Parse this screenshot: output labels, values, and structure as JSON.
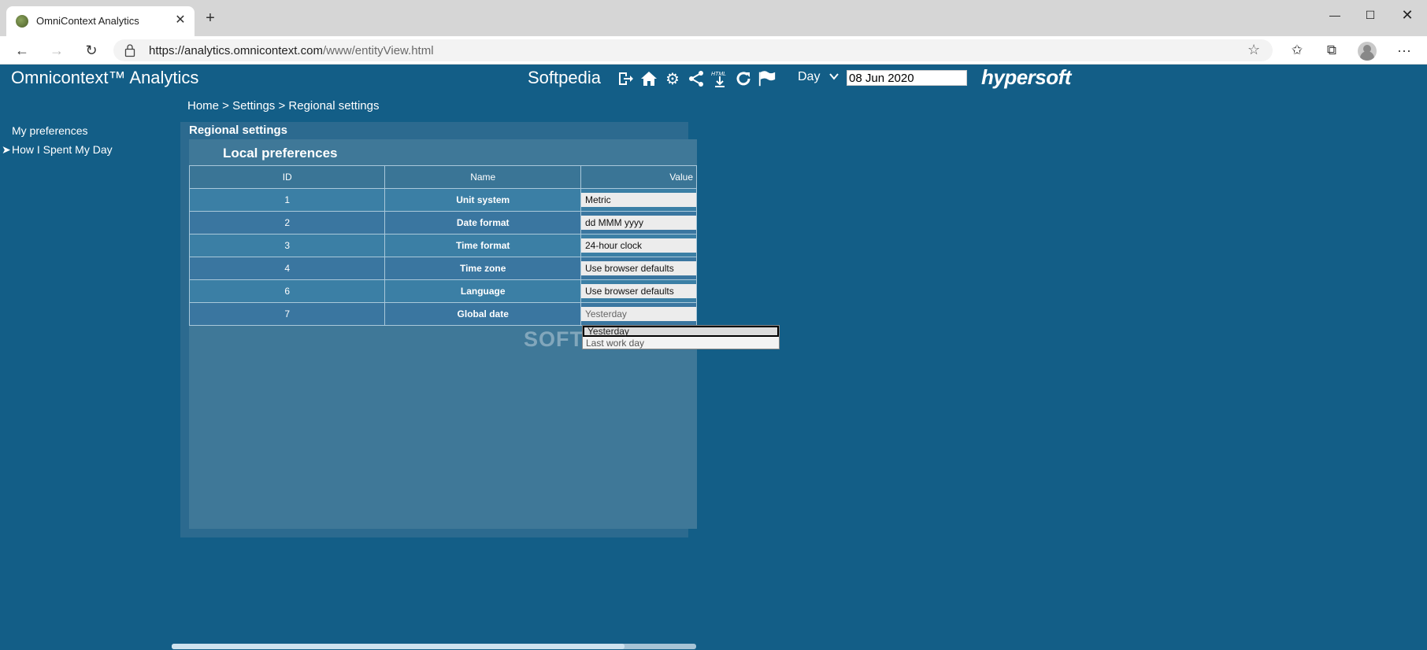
{
  "browser": {
    "tab_title": "OmniContext Analytics",
    "url_scheme": "https://",
    "url_host": "analytics.omnicontext.com",
    "url_path": "/www/entityView.html"
  },
  "app": {
    "title": "Omnicontext™ Analytics",
    "user_label": "Softpedia",
    "period_label": "Day",
    "date_value": "08 Jun 2020",
    "brand": "hypersoft",
    "toolbar_icons": [
      "logout-icon",
      "home-icon",
      "gear-icon",
      "share-icon",
      "html-export-icon",
      "refresh-icon",
      "flag-icon"
    ]
  },
  "breadcrumb": "Home > Settings > Regional settings",
  "sidebar": {
    "items": [
      {
        "label": "My preferences"
      },
      {
        "label": "How I Spent My Day"
      }
    ],
    "active_marker": "➤"
  },
  "panel": {
    "title": "Regional settings",
    "subtitle": "Local preferences",
    "columns": [
      "ID",
      "Name",
      "Value"
    ],
    "rows": [
      {
        "id": "1",
        "name": "Unit system",
        "value": "Metric"
      },
      {
        "id": "2",
        "name": "Date format",
        "value": "dd MMM yyyy"
      },
      {
        "id": "3",
        "name": "Time format",
        "value": "24-hour clock"
      },
      {
        "id": "4",
        "name": "Time zone",
        "value": "Use browser defaults"
      },
      {
        "id": "6",
        "name": "Language",
        "value": "Use browser defaults"
      },
      {
        "id": "7",
        "name": "Global date",
        "value": "Yesterday"
      }
    ]
  },
  "dropdown": {
    "options": [
      "Yesterday",
      "Last work day"
    ]
  },
  "watermark": "SOFTPEDIA"
}
